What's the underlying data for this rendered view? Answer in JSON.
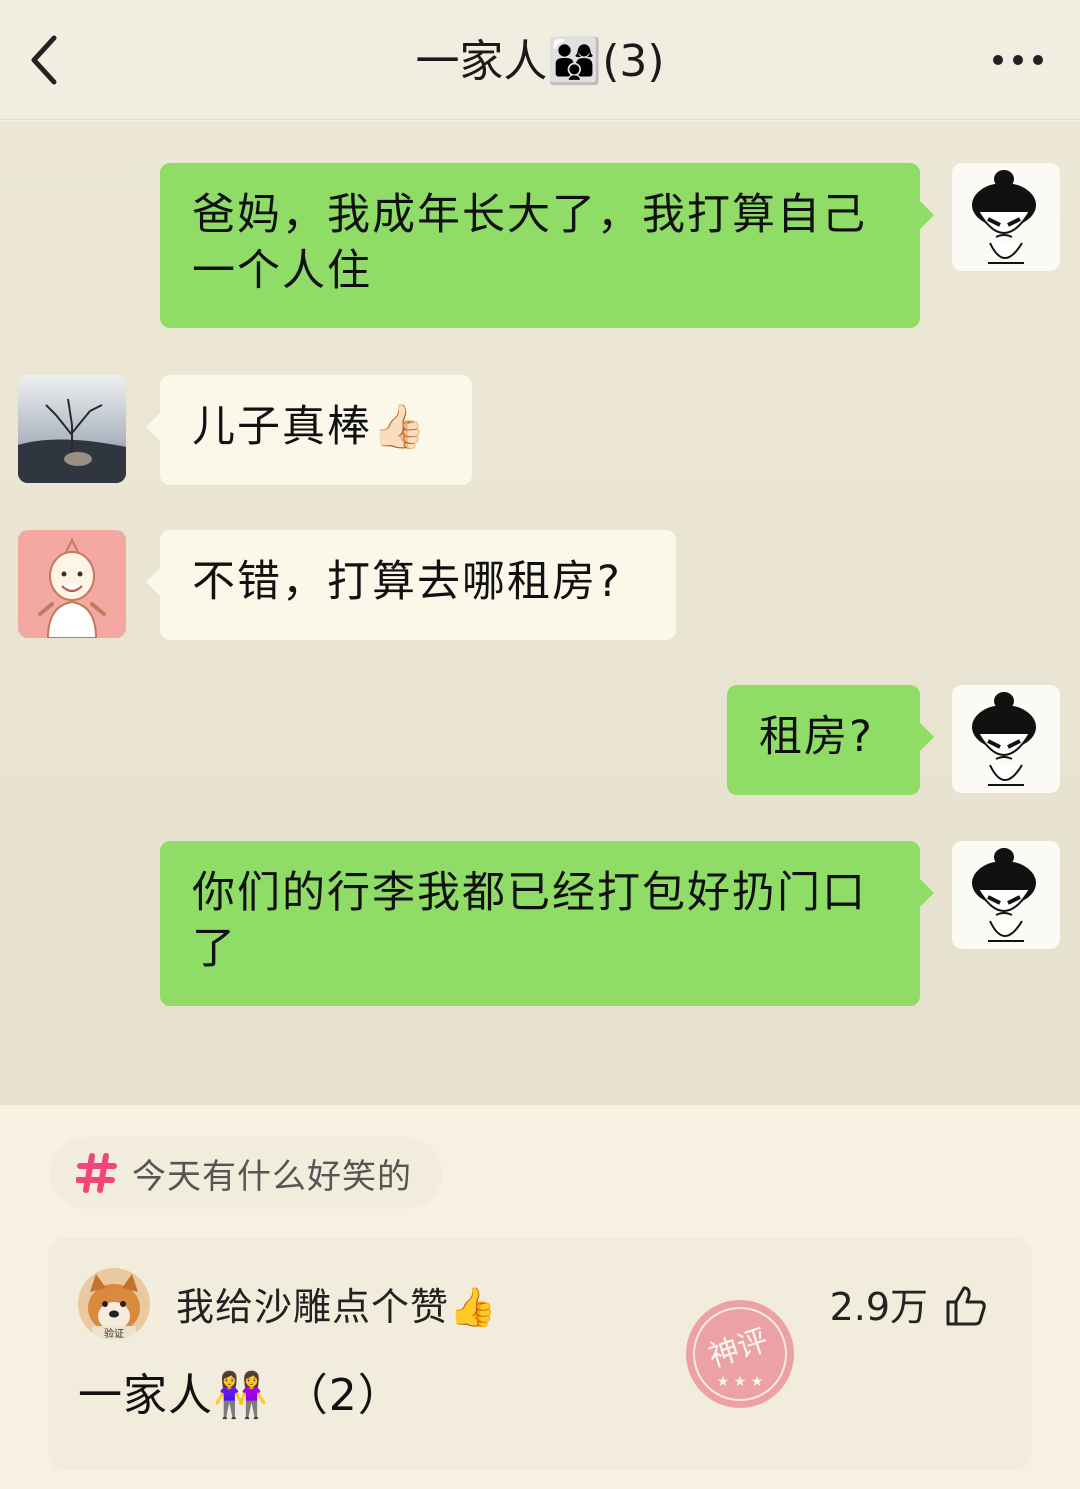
{
  "header": {
    "title": "一家人👨‍👩‍👦(3)",
    "back_icon": "chevron-left-icon",
    "more_icon": "more-dots-icon"
  },
  "messages": [
    {
      "side": "out",
      "sender": "son",
      "text": "爸妈，我成年长大了，我打算自己一个人住"
    },
    {
      "side": "in",
      "sender": "dad",
      "text": "儿子真棒👍🏻"
    },
    {
      "side": "in",
      "sender": "mom",
      "text": "不错，打算去哪租房?"
    },
    {
      "side": "out",
      "sender": "son",
      "text": "租房?"
    },
    {
      "side": "out",
      "sender": "son",
      "text": "你们的行李我都已经打包好扔门口了"
    }
  ],
  "post": {
    "topic": "今天有什么好笑的",
    "topic_icon": "hashtag-icon",
    "comment": {
      "user_name": "我给沙雕点个赞👍",
      "avatar_badge": "验证",
      "like_count": "2.9万",
      "like_icon": "thumbs-up-icon",
      "text": "一家人👭 （2）",
      "stamp_text": "神评"
    }
  },
  "colors": {
    "outgoing_bubble": "#8fdc67",
    "incoming_bubble": "#fbf8ea",
    "header_bg": "#f1ede0",
    "page_bg": "#f6f1e1",
    "topic_hash": "#f0467a",
    "stamp": "#e8677a"
  }
}
